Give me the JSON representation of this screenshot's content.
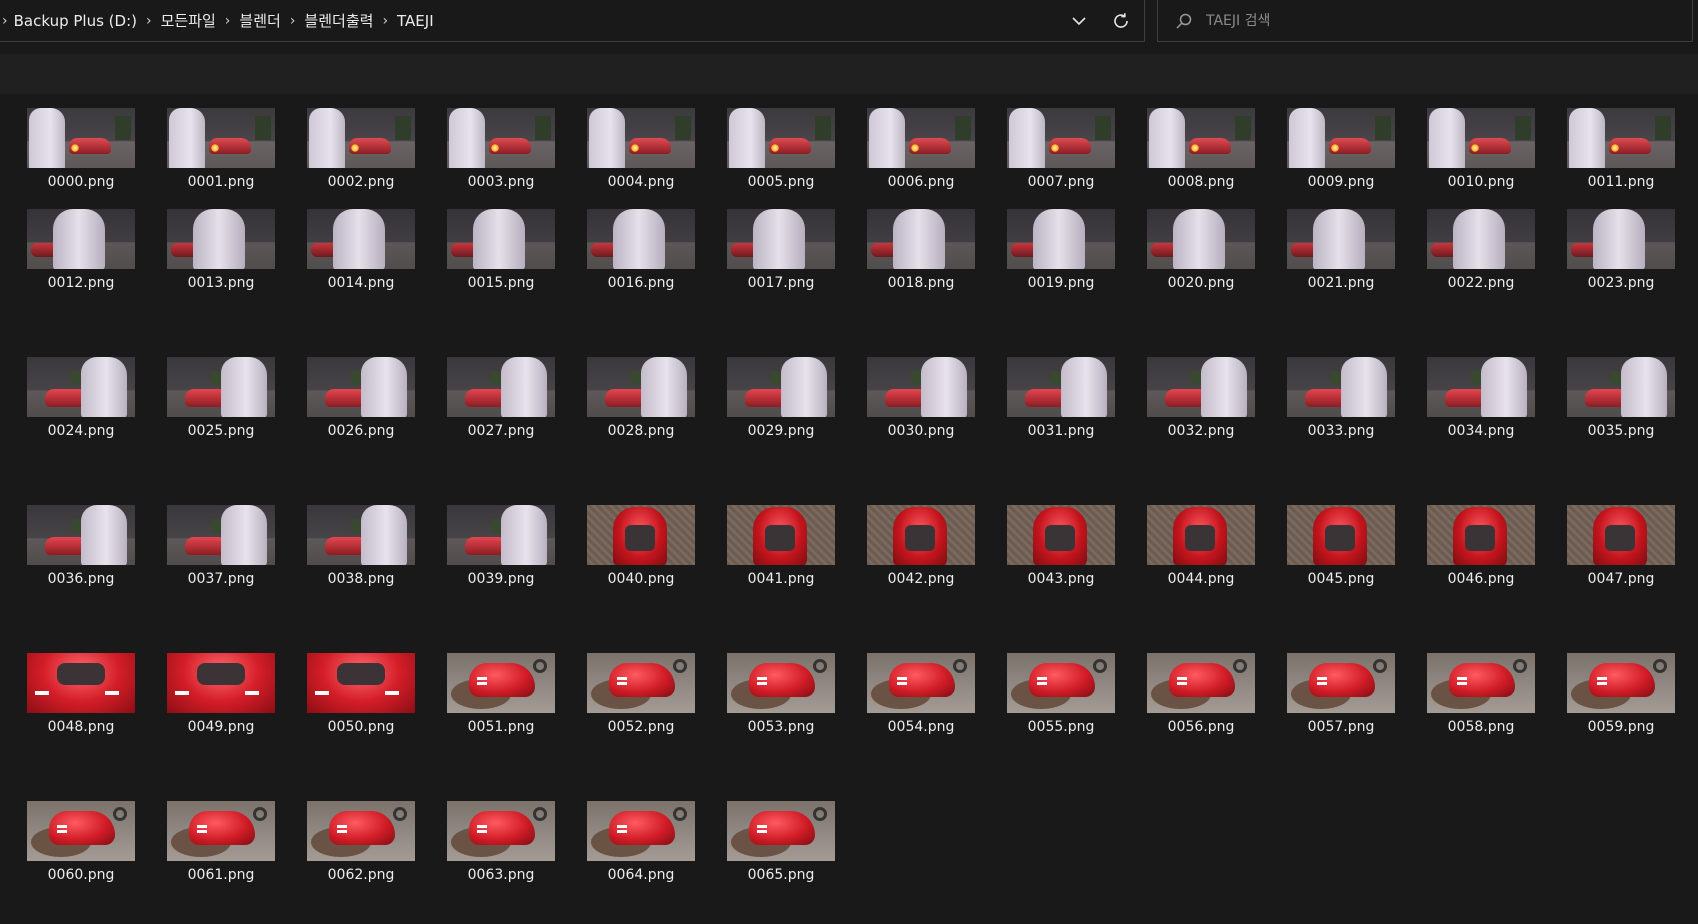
{
  "address_bar": {
    "breadcrumbs": [
      "Backup Plus (D:)",
      "모든파일",
      "블렌더",
      "블렌더출력",
      "TAEJI"
    ]
  },
  "search": {
    "placeholder": "TAEJI 검색"
  },
  "files": [
    {
      "name": "0000.png",
      "scene": "a"
    },
    {
      "name": "0001.png",
      "scene": "a"
    },
    {
      "name": "0002.png",
      "scene": "a"
    },
    {
      "name": "0003.png",
      "scene": "a"
    },
    {
      "name": "0004.png",
      "scene": "a"
    },
    {
      "name": "0005.png",
      "scene": "a"
    },
    {
      "name": "0006.png",
      "scene": "a"
    },
    {
      "name": "0007.png",
      "scene": "a"
    },
    {
      "name": "0008.png",
      "scene": "a"
    },
    {
      "name": "0009.png",
      "scene": "a"
    },
    {
      "name": "0010.png",
      "scene": "a"
    },
    {
      "name": "0011.png",
      "scene": "a"
    },
    {
      "name": "0012.png",
      "scene": "b"
    },
    {
      "name": "0013.png",
      "scene": "b"
    },
    {
      "name": "0014.png",
      "scene": "b"
    },
    {
      "name": "0015.png",
      "scene": "b"
    },
    {
      "name": "0016.png",
      "scene": "b"
    },
    {
      "name": "0017.png",
      "scene": "b"
    },
    {
      "name": "0018.png",
      "scene": "b"
    },
    {
      "name": "0019.png",
      "scene": "b"
    },
    {
      "name": "0020.png",
      "scene": "b"
    },
    {
      "name": "0021.png",
      "scene": "b"
    },
    {
      "name": "0022.png",
      "scene": "b"
    },
    {
      "name": "0023.png",
      "scene": "b"
    },
    {
      "name": "0024.png",
      "scene": "c"
    },
    {
      "name": "0025.png",
      "scene": "c"
    },
    {
      "name": "0026.png",
      "scene": "c"
    },
    {
      "name": "0027.png",
      "scene": "c"
    },
    {
      "name": "0028.png",
      "scene": "c"
    },
    {
      "name": "0029.png",
      "scene": "c"
    },
    {
      "name": "0030.png",
      "scene": "c"
    },
    {
      "name": "0031.png",
      "scene": "c"
    },
    {
      "name": "0032.png",
      "scene": "c"
    },
    {
      "name": "0033.png",
      "scene": "c"
    },
    {
      "name": "0034.png",
      "scene": "c"
    },
    {
      "name": "0035.png",
      "scene": "c"
    },
    {
      "name": "0036.png",
      "scene": "c"
    },
    {
      "name": "0037.png",
      "scene": "c"
    },
    {
      "name": "0038.png",
      "scene": "c"
    },
    {
      "name": "0039.png",
      "scene": "c"
    },
    {
      "name": "0040.png",
      "scene": "d"
    },
    {
      "name": "0041.png",
      "scene": "d"
    },
    {
      "name": "0042.png",
      "scene": "d"
    },
    {
      "name": "0043.png",
      "scene": "d"
    },
    {
      "name": "0044.png",
      "scene": "d"
    },
    {
      "name": "0045.png",
      "scene": "d"
    },
    {
      "name": "0046.png",
      "scene": "d"
    },
    {
      "name": "0047.png",
      "scene": "d"
    },
    {
      "name": "0048.png",
      "scene": "e"
    },
    {
      "name": "0049.png",
      "scene": "e"
    },
    {
      "name": "0050.png",
      "scene": "e"
    },
    {
      "name": "0051.png",
      "scene": "f"
    },
    {
      "name": "0052.png",
      "scene": "f"
    },
    {
      "name": "0053.png",
      "scene": "f"
    },
    {
      "name": "0054.png",
      "scene": "f"
    },
    {
      "name": "0055.png",
      "scene": "f"
    },
    {
      "name": "0056.png",
      "scene": "f"
    },
    {
      "name": "0057.png",
      "scene": "f"
    },
    {
      "name": "0058.png",
      "scene": "f"
    },
    {
      "name": "0059.png",
      "scene": "f"
    },
    {
      "name": "0060.png",
      "scene": "f"
    },
    {
      "name": "0061.png",
      "scene": "f"
    },
    {
      "name": "0062.png",
      "scene": "f"
    },
    {
      "name": "0063.png",
      "scene": "f"
    },
    {
      "name": "0064.png",
      "scene": "f"
    },
    {
      "name": "0065.png",
      "scene": "f"
    }
  ],
  "colors": {
    "background": "#191919",
    "command_bar": "#202020",
    "border": "#3d3d3d",
    "text": "#ededed",
    "placeholder": "#8a8a8a"
  }
}
